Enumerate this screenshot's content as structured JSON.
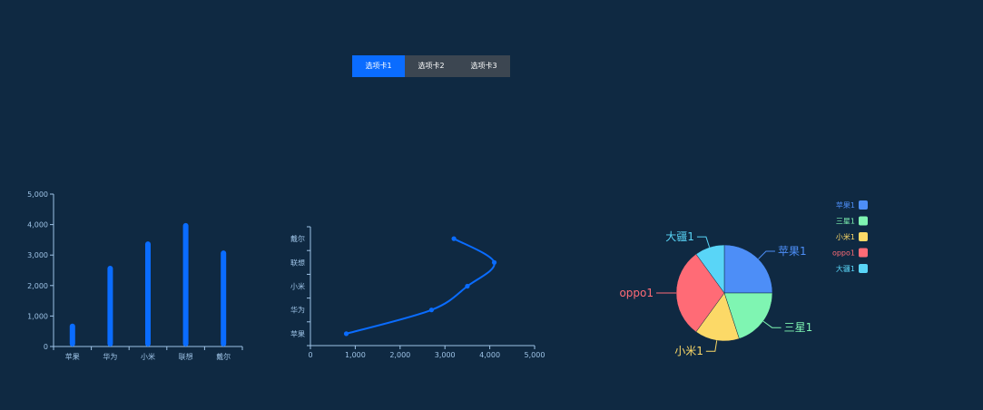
{
  "tabs": [
    {
      "label": "选项卡1",
      "active": true
    },
    {
      "label": "选项卡2",
      "active": false
    },
    {
      "label": "选项卡3",
      "active": false
    }
  ],
  "colors": {
    "background": "#0f2942",
    "accent": "#0a6cff",
    "axis": "#9ec3e6",
    "tab_inactive": "#3c4651"
  },
  "chart_data": [
    {
      "type": "bar",
      "categories": [
        "苹果",
        "华为",
        "小米",
        "联想",
        "戴尔"
      ],
      "values": [
        750,
        2650,
        3450,
        4050,
        3150
      ],
      "ylim": [
        0,
        5000
      ],
      "yticks": [
        "0",
        "1,000",
        "2,000",
        "3,000",
        "4,000",
        "5,000"
      ],
      "bar_color": "#0a6cff"
    },
    {
      "type": "line",
      "orientation": "horizontal",
      "categories": [
        "苹果",
        "华为",
        "小米",
        "联想",
        "戴尔"
      ],
      "values": [
        800,
        2700,
        3500,
        4100,
        3200
      ],
      "xlim": [
        0,
        5000
      ],
      "xticks": [
        "0",
        "1,000",
        "2,000",
        "3,000",
        "4,000",
        "5,000"
      ],
      "smooth": true,
      "line_color": "#0a6cff"
    },
    {
      "type": "pie",
      "slices": [
        {
          "label": "苹果1",
          "value": 25,
          "color": "#4d8ef7"
        },
        {
          "label": "三星1",
          "value": 20,
          "color": "#7ff5b2"
        },
        {
          "label": "小米1",
          "value": 15,
          "color": "#fcd967"
        },
        {
          "label": "oppo1",
          "value": 30,
          "color": "#ff6b76"
        },
        {
          "label": "大疆1",
          "value": 10,
          "color": "#59d5f7"
        }
      ],
      "legend": [
        "苹果1",
        "三星1",
        "小米1",
        "oppo1",
        "大疆1"
      ],
      "legend_position": "top-right"
    }
  ]
}
